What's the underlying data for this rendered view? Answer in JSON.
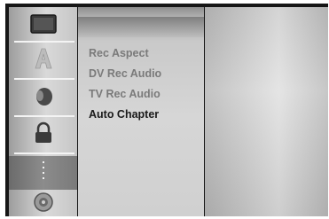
{
  "sidebar": {
    "icons": [
      {
        "name": "disc-icon"
      },
      {
        "name": "language-icon"
      },
      {
        "name": "audio-icon"
      },
      {
        "name": "lock-icon"
      },
      {
        "name": "more-icon"
      },
      {
        "name": "disc-setup-icon"
      }
    ],
    "selected_index": 4
  },
  "submenu": {
    "items": [
      {
        "label": "Rec Aspect"
      },
      {
        "label": "DV Rec Audio"
      },
      {
        "label": "TV Rec Audio"
      },
      {
        "label": "Auto Chapter"
      }
    ],
    "active_index": 3
  },
  "colors": {
    "frame": "#161616",
    "text_dim": "#7a7a7a",
    "text_active": "#1a1a1a"
  }
}
